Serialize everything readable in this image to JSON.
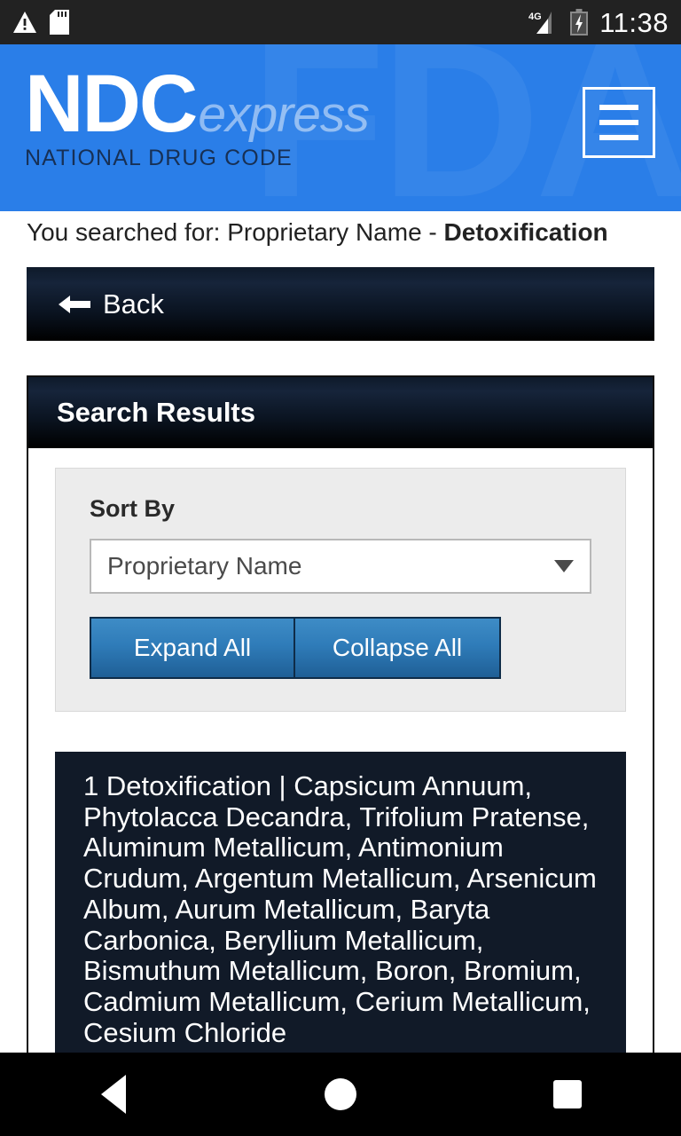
{
  "statusbar": {
    "icons": [
      "warning-triangle-icon",
      "sd-card-icon",
      "signal-4g-icon",
      "battery-charging-icon"
    ],
    "network_label": "4G",
    "time": "11:38"
  },
  "header": {
    "brand_primary": "NDC",
    "brand_secondary": "express",
    "brand_subtitle": "NATIONAL DRUG CODE",
    "watermark": "FDA",
    "menu_label": "menu",
    "bg_color": "#2a7ee8"
  },
  "search_summary": {
    "prefix": "You searched for: Proprietary Name - ",
    "term": "Detoxification"
  },
  "back": {
    "label": "Back"
  },
  "results_card": {
    "title": "Search Results",
    "sort": {
      "label": "Sort By",
      "selected": "Proprietary Name",
      "options": [
        "Proprietary Name"
      ]
    },
    "expand_all_label": "Expand All",
    "collapse_all_label": "Collapse All",
    "items": [
      {
        "index": "1",
        "text": "1 Detoxification | Capsicum Annuum, Phytolacca Decandra, Trifolium Pratense, Aluminum Metallicum, Antimonium Crudum, Argentum Metallicum, Arsenicum Album, Aurum Metallicum, Baryta Carbonica, Beryllium Metallicum, Bismuthum Metallicum, Boron, Bromium, Cadmium Metallicum, Cerium Metallicum, Cesium Chloride"
      }
    ]
  },
  "navbar": {
    "back": "back-triangle-icon",
    "home": "home-circle-icon",
    "recents": "recents-square-icon"
  }
}
